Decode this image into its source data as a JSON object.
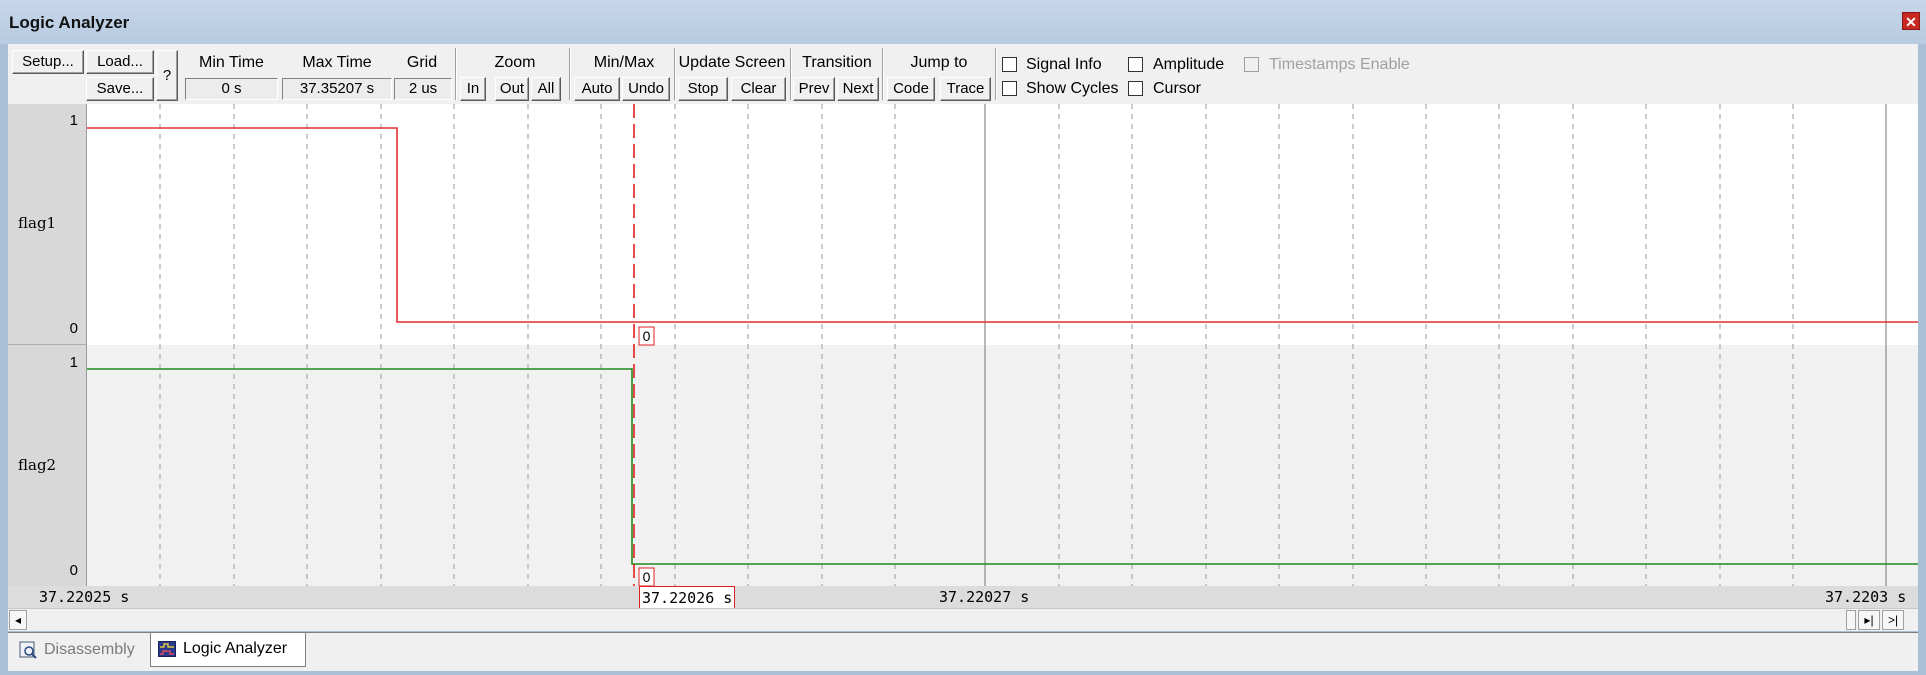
{
  "window": {
    "title": "Logic Analyzer"
  },
  "toolbar": {
    "setup": "Setup...",
    "load": "Load...",
    "save": "Save...",
    "help": "?",
    "min_time": {
      "label": "Min Time",
      "value": "0 s"
    },
    "max_time": {
      "label": "Max Time",
      "value": "37.35207 s"
    },
    "grid": {
      "label": "Grid",
      "value": "2 us"
    },
    "zoom": {
      "label": "Zoom",
      "in": "In",
      "out": "Out",
      "all": "All"
    },
    "minmax": {
      "label": "Min/Max",
      "auto": "Auto",
      "undo": "Undo"
    },
    "update_screen": {
      "label": "Update Screen",
      "stop": "Stop",
      "clear": "Clear"
    },
    "transition": {
      "label": "Transition",
      "prev": "Prev",
      "next": "Next"
    },
    "jump_to": {
      "label": "Jump to",
      "code": "Code",
      "trace": "Trace"
    },
    "options": {
      "signal_info": {
        "label": "Signal Info",
        "checked": false
      },
      "show_cycles": {
        "label": "Show Cycles",
        "checked": false
      },
      "amplitude": {
        "label": "Amplitude",
        "checked": false
      },
      "cursor": {
        "label": "Cursor",
        "checked": false
      },
      "timestamps_enable": {
        "label": "Timestamps Enable",
        "checked": false,
        "disabled": true
      }
    }
  },
  "signals": [
    {
      "name": "flag1",
      "high_label": "1",
      "low_label": "0",
      "color": "#e03030",
      "cursor_value": "0"
    },
    {
      "name": "flag2",
      "high_label": "1",
      "low_label": "0",
      "color": "#1f8c1f",
      "cursor_value": "0"
    }
  ],
  "time_axis": {
    "left": "37.22025 s",
    "cursor": "37.22026 s",
    "mid": "37.22027 s",
    "right": "37.2203 s"
  },
  "colors": {
    "cursor": "#e02020",
    "grid": "#888888"
  },
  "tabs": [
    {
      "label": "Disassembly",
      "active": false
    },
    {
      "label": "Logic Analyzer",
      "active": true
    }
  ]
}
